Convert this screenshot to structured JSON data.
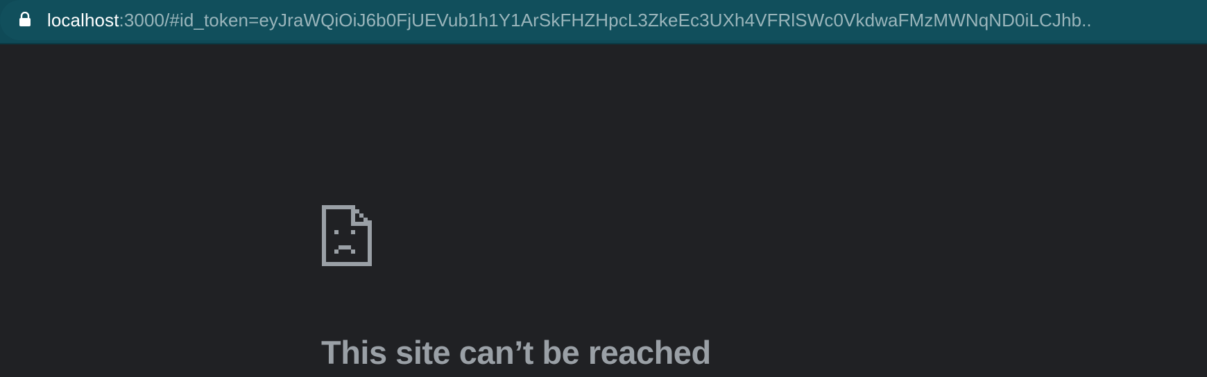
{
  "address_bar": {
    "url_host": "localhost",
    "url_rest": ":3000/#id_token=eyJraWQiOiJ6b0FjUEVub1h1Y1ArSkFHZHpcL3ZkeEc3UXh4VFRlSWc0VkdwaFMzMWNqND0iLCJhb..",
    "lock_icon": "lock-icon"
  },
  "error_page": {
    "icon": "sad-page-icon",
    "title": "This site can’t be reached"
  },
  "colors": {
    "address_bar_bg": "#114f5c",
    "page_bg": "#202124",
    "title_color": "#9aa0a6",
    "url_host_color": "#ffffff",
    "url_rest_color": "#9ab5bb"
  }
}
